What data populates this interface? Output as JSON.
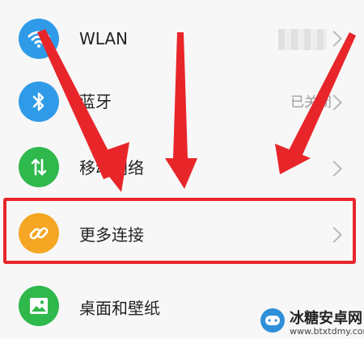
{
  "settings": {
    "items": [
      {
        "label": "WLAN",
        "value": "",
        "icon": "wifi-icon",
        "color": "#2f9be8"
      },
      {
        "label": "蓝牙",
        "value": "已关闭",
        "icon": "bluetooth-icon",
        "color": "#2f9be8"
      },
      {
        "label": "移动网络",
        "value": "",
        "icon": "mobile-data-icon",
        "color": "#2fb84c"
      },
      {
        "label": "更多连接",
        "value": "",
        "icon": "link-icon",
        "color": "#f5a623"
      },
      {
        "label": "桌面和壁纸",
        "value": "",
        "icon": "image-icon",
        "color": "#2fb84c"
      }
    ]
  },
  "annotation": {
    "highlight_color": "#e8262a"
  },
  "watermark": {
    "title": "冰糖安卓网",
    "url": "www.btxtdmy.com"
  }
}
